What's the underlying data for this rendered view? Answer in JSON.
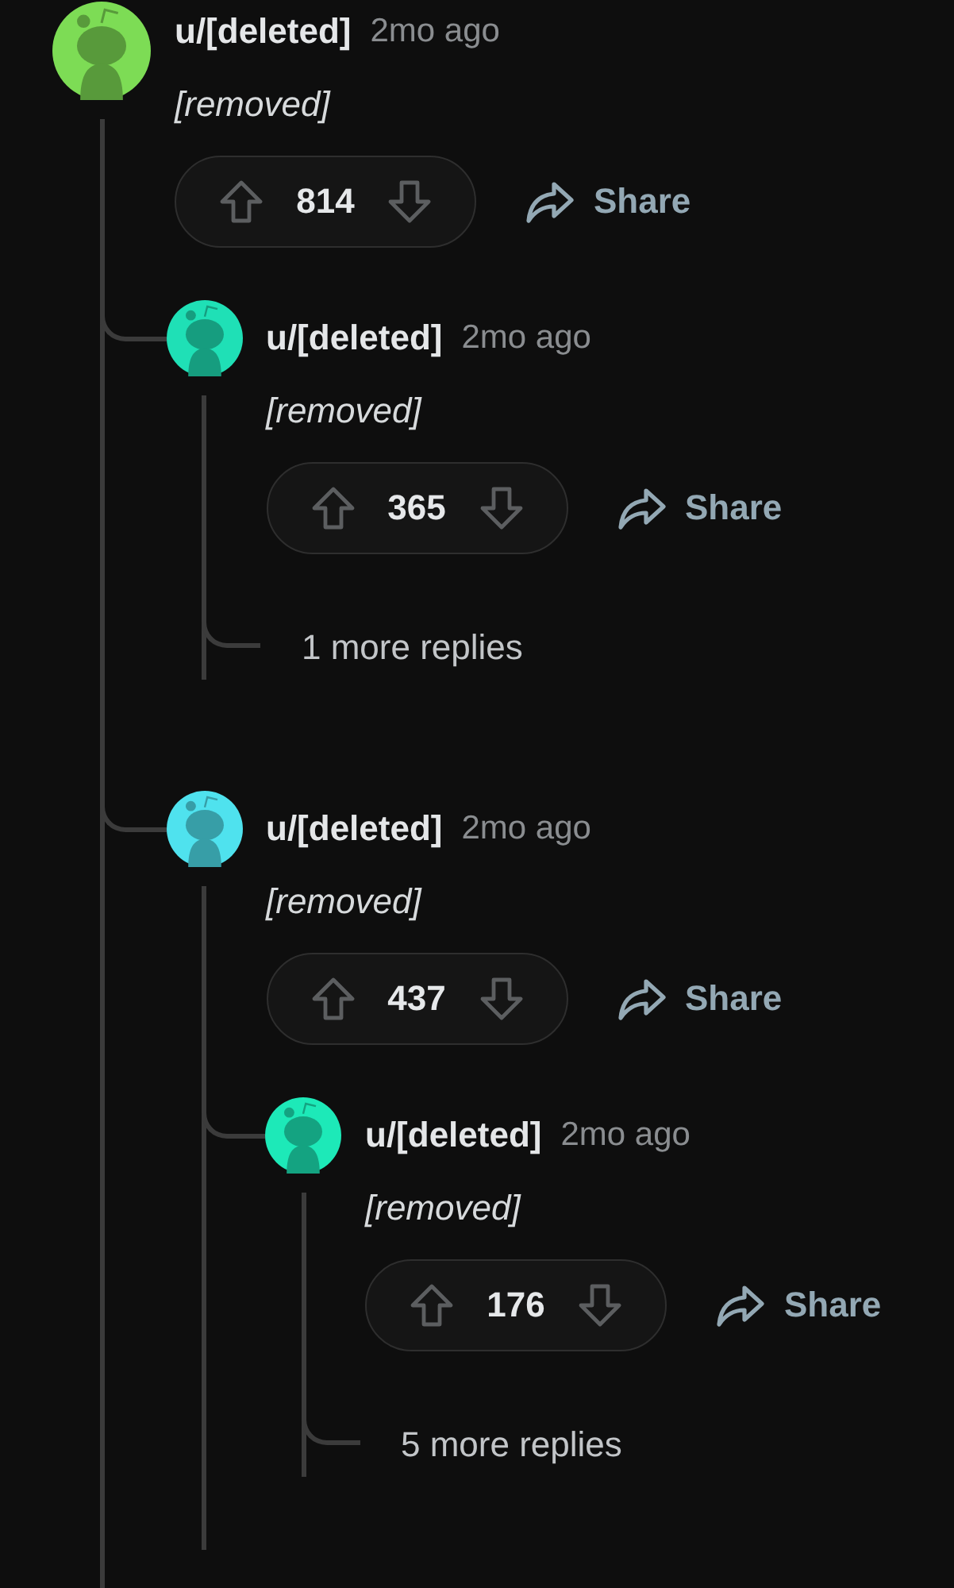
{
  "comments": [
    {
      "kind": "comment",
      "author": "u/[deleted]",
      "time": "2mo ago",
      "body": "[removed]",
      "score": "814",
      "share": "Share",
      "color": "#7ddc55",
      "children": [
        {
          "kind": "comment",
          "author": "u/[deleted]",
          "time": "2mo ago",
          "body": "[removed]",
          "score": "365",
          "share": "Share",
          "color": "#1fe0b6",
          "children": [
            {
              "kind": "more",
              "label": "1 more replies"
            }
          ]
        },
        {
          "kind": "comment",
          "author": "u/[deleted]",
          "time": "2mo ago",
          "body": "[removed]",
          "score": "437",
          "share": "Share",
          "color": "#4fe2ee",
          "children": [
            {
              "kind": "comment",
              "author": "u/[deleted]",
              "time": "2mo ago",
              "body": "[removed]",
              "score": "176",
              "share": "Share",
              "color": "#1de9b8",
              "children": [
                {
                  "kind": "more",
                  "label": "5 more replies"
                }
              ]
            }
          ]
        }
      ]
    }
  ]
}
